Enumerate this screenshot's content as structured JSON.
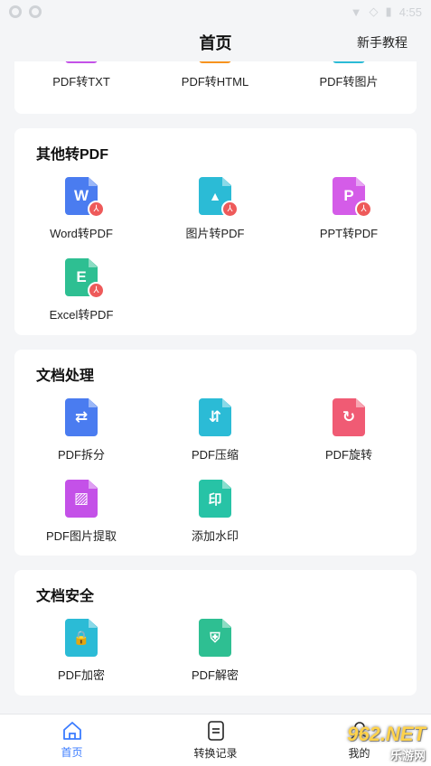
{
  "status": {
    "time": "4:55"
  },
  "header": {
    "title": "首页",
    "tutorial": "新手教程"
  },
  "sections": [
    {
      "title": "",
      "items": [
        {
          "label": "PDF转TXT",
          "icon": "pdf-to-txt-icon",
          "color": "#c451e8"
        },
        {
          "label": "PDF转HTML",
          "icon": "pdf-to-html-icon",
          "color": "#f7931e"
        },
        {
          "label": "PDF转图片",
          "icon": "pdf-to-image-icon",
          "color": "#2bbbd6"
        }
      ]
    },
    {
      "title": "其他转PDF",
      "items": [
        {
          "label": "Word转PDF",
          "icon": "word-to-pdf-icon",
          "color": "#4a7cf0",
          "glyph": "W"
        },
        {
          "label": "图片转PDF",
          "icon": "image-to-pdf-icon",
          "color": "#2bbbd6",
          "glyph": "▲"
        },
        {
          "label": "PPT转PDF",
          "icon": "ppt-to-pdf-icon",
          "color": "#d45ce8",
          "glyph": "P"
        },
        {
          "label": "Excel转PDF",
          "icon": "excel-to-pdf-icon",
          "color": "#2ebf92",
          "glyph": "E"
        }
      ]
    },
    {
      "title": "文档处理",
      "items": [
        {
          "label": "PDF拆分",
          "icon": "pdf-split-icon",
          "color": "#4a7cf0",
          "glyph": "⇄"
        },
        {
          "label": "PDF压缩",
          "icon": "pdf-compress-icon",
          "color": "#2bbbd6",
          "glyph": "⇵"
        },
        {
          "label": "PDF旋转",
          "icon": "pdf-rotate-icon",
          "color": "#f05b74",
          "glyph": "↻"
        },
        {
          "label": "PDF图片提取",
          "icon": "pdf-image-extract-icon",
          "color": "#c451e8",
          "glyph": "▨"
        },
        {
          "label": "添加水印",
          "icon": "add-watermark-icon",
          "color": "#27c3a6",
          "glyph": "印"
        }
      ]
    },
    {
      "title": "文档安全",
      "items": [
        {
          "label": "PDF加密",
          "icon": "pdf-encrypt-icon",
          "color": "#2bbbd6",
          "glyph": "🔒"
        },
        {
          "label": "PDF解密",
          "icon": "pdf-decrypt-icon",
          "color": "#2ebf92",
          "glyph": "⛨"
        }
      ]
    }
  ],
  "nav": [
    {
      "label": "首页",
      "icon": "home-icon",
      "active": true
    },
    {
      "label": "转换记录",
      "icon": "record-icon",
      "active": false
    },
    {
      "label": "我的",
      "icon": "profile-icon",
      "active": false
    }
  ],
  "watermark": {
    "line1": "962.NET",
    "line2": "乐游网"
  }
}
